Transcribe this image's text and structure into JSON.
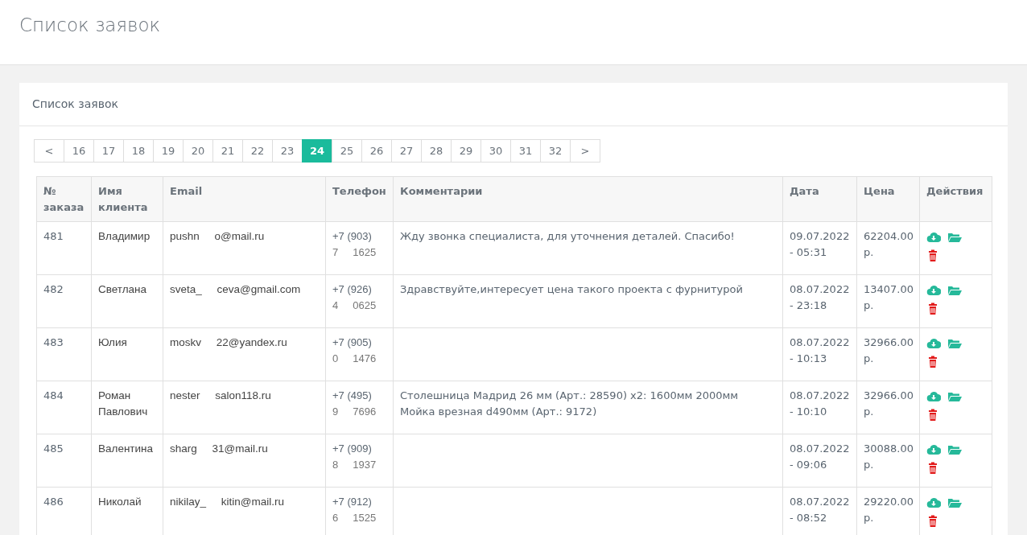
{
  "page_title": "Список заявок",
  "panel": {
    "title": "Список заявок"
  },
  "pagination": [
    {
      "label": "<",
      "selected": false
    },
    {
      "label": "16",
      "selected": false
    },
    {
      "label": "17",
      "selected": false
    },
    {
      "label": "18",
      "selected": false
    },
    {
      "label": "19",
      "selected": false
    },
    {
      "label": "20",
      "selected": false
    },
    {
      "label": "21",
      "selected": false
    },
    {
      "label": "22",
      "selected": false
    },
    {
      "label": "23",
      "selected": false
    },
    {
      "label": "24",
      "selected": true
    },
    {
      "label": "25",
      "selected": false
    },
    {
      "label": "26",
      "selected": false
    },
    {
      "label": "27",
      "selected": false
    },
    {
      "label": "28",
      "selected": false
    },
    {
      "label": "29",
      "selected": false
    },
    {
      "label": "30",
      "selected": false
    },
    {
      "label": "31",
      "selected": false
    },
    {
      "label": "32",
      "selected": false
    },
    {
      "label": ">",
      "selected": false
    }
  ],
  "table": {
    "columns": [
      "№ заказа",
      "Имя клиента",
      "Email",
      "Телефон",
      "Комментарии",
      "Дата",
      "Цена",
      "Действия"
    ],
    "rows": [
      {
        "id": "481",
        "name": "Владимир",
        "email": "pushn     o@mail.ru",
        "phone": [
          "+7 (903)",
          "7     1625"
        ],
        "comment": "Жду звонка специалиста, для уточнения деталей. Спасибо!",
        "date": "09.07.2022 - 05:31",
        "price": "62204.00 р."
      },
      {
        "id": "482",
        "name": "Светлана",
        "email": "sveta_     ceva@gmail.com",
        "phone": [
          "+7 (926)",
          "4     0625"
        ],
        "comment": "Здравствуйте,интересует цена такого проекта с фурнитурой",
        "date": "08.07.2022 - 23:18",
        "price": "13407.00 р."
      },
      {
        "id": "483",
        "name": "Юлия",
        "email": "moskv     22@yandex.ru",
        "phone": [
          "+7 (905)",
          "0     1476"
        ],
        "comment": "",
        "date": "08.07.2022 - 10:13",
        "price": "32966.00 р."
      },
      {
        "id": "484",
        "name": "Роман Павлович",
        "email": "nester     salon118.ru",
        "phone": [
          "+7 (495)",
          "9     7696"
        ],
        "comment": "Столешница Мадрид 26 мм (Арт.: 28590) x2: 1600мм 2000мм Мойка врезная d490мм (Арт.: 9172)",
        "date": "08.07.2022 - 10:10",
        "price": "32966.00 р."
      },
      {
        "id": "485",
        "name": "Валентина",
        "email": "sharg     31@mail.ru",
        "phone": [
          "+7 (909)",
          "8     1937"
        ],
        "comment": "",
        "date": "08.07.2022 - 09:06",
        "price": "30088.00 р."
      },
      {
        "id": "486",
        "name": "Николай",
        "email": "nikilay_     kitin@mail.ru",
        "phone": [
          "+7 (912)",
          "6     1525"
        ],
        "comment": "",
        "date": "08.07.2022 - 08:52",
        "price": "29220.00 р."
      }
    ]
  }
}
